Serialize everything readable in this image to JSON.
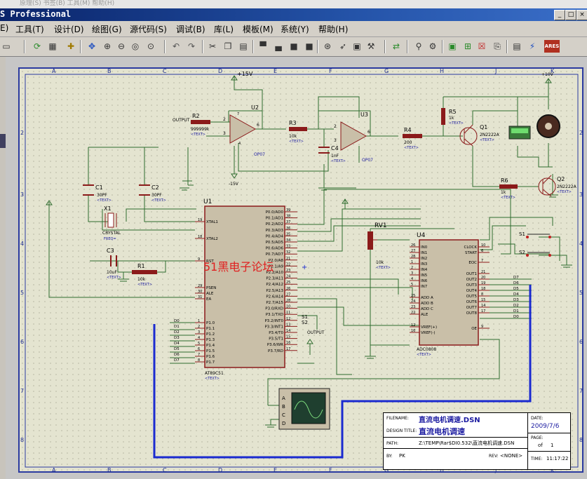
{
  "window": {
    "title": "ISIS Professional",
    "title_partial": "S Professional",
    "ghost_menu": "原理(S)   书签(B)   工具(M)   帮助(H)",
    "buttons": [
      "_",
      "□",
      "×"
    ]
  },
  "menu": [
    "E)",
    "工具(T)",
    "设计(D)",
    "绘图(G)",
    "源代码(S)",
    "调试(B)",
    "库(L)",
    "模板(M)",
    "系统(Y)",
    "帮助(H)"
  ],
  "toolbar_icons": [
    "file-icon",
    "refresh-icon",
    "crosshair-icon",
    "pan-icon",
    "zoom-in-icon",
    "zoom-out-icon",
    "zoom-all-icon",
    "zoom-area-icon",
    "undo-icon",
    "redo-icon",
    "cut-icon",
    "copy-icon",
    "paste-icon",
    "block-copy-icon",
    "block-move-icon",
    "block-rotate-icon",
    "block-delete-icon",
    "pick-device-icon",
    "make-device-icon",
    "package-icon",
    "decompose-icon",
    "wire-autorouter-icon",
    "search-tag-icon",
    "property-assign-icon",
    "new-sheet-icon",
    "remove-sheet-icon",
    "goto-sheet-icon",
    "bill-of-materials-icon",
    "electrical-rules-icon",
    "netlist-ares-icon"
  ],
  "grid": {
    "columns": [
      "A",
      "B",
      "C",
      "D",
      "E",
      "F",
      "G",
      "H",
      "J",
      "K"
    ],
    "rows": [
      "1",
      "2",
      "3",
      "4",
      "5",
      "6",
      "7",
      "8",
      "9"
    ]
  },
  "schematic": {
    "power": {
      "pos15": "+15V",
      "neg15": "-15V",
      "pos10": "+10V"
    },
    "opamps": [
      {
        "ref": "U2",
        "part": "OP07",
        "pins": {
          "in_minus": "2",
          "in_plus": "3",
          "out": "6",
          "v_plus": "7",
          "v_minus": "4",
          "n1": "1",
          "n8": "8"
        }
      },
      {
        "ref": "U3",
        "part": "OP07",
        "pins": {
          "in_minus": "2",
          "in_plus": "3",
          "out": "6",
          "v_plus": "7",
          "v_minus": "4",
          "n1": "1",
          "n8": "8"
        }
      }
    ],
    "resistors": [
      {
        "ref": "R2",
        "value": "999999k"
      },
      {
        "ref": "R3",
        "value": "10k"
      },
      {
        "ref": "R4",
        "value": "200"
      },
      {
        "ref": "R5",
        "value": "1k"
      },
      {
        "ref": "R6",
        "value": "1k"
      },
      {
        "ref": "R1",
        "value": "10k"
      }
    ],
    "text_placeholder": "<TEXT>",
    "capacitors": [
      {
        "ref": "C1",
        "value": "30PF"
      },
      {
        "ref": "C2",
        "value": "30PF"
      },
      {
        "ref": "C3",
        "value": "10uF"
      },
      {
        "ref": "C4",
        "value": "1nF"
      }
    ],
    "transistors": [
      {
        "ref": "Q1",
        "part": "2N2222A"
      },
      {
        "ref": "Q2",
        "part": "2N2222A"
      }
    ],
    "crystal": {
      "ref": "X1",
      "part": "CRYSTAL",
      "freq": "FREQ="
    },
    "output_label": "OUTPUT",
    "rv1": {
      "ref": "RV1",
      "value": "10k"
    },
    "switches": [
      "S1",
      "S2"
    ],
    "u1": {
      "ref": "U1",
      "part": "AT89C51",
      "left_pins": [
        {
          "num": "19",
          "name": "XTAL1"
        },
        {
          "num": "18",
          "name": "XTAL2"
        },
        {
          "num": "9",
          "name": "RST"
        },
        {
          "num": "29",
          "name": "PSEN"
        },
        {
          "num": "30",
          "name": "ALE"
        },
        {
          "num": "31",
          "name": "EA"
        },
        {
          "num": "1",
          "name": "P1.0"
        },
        {
          "num": "2",
          "name": "P1.1"
        },
        {
          "num": "3",
          "name": "P1.2"
        },
        {
          "num": "4",
          "name": "P1.3"
        },
        {
          "num": "5",
          "name": "P1.4"
        },
        {
          "num": "6",
          "name": "P1.5"
        },
        {
          "num": "7",
          "name": "P1.6"
        },
        {
          "num": "8",
          "name": "P1.7"
        }
      ],
      "right_pins": [
        {
          "num": "39",
          "name": "P0.0/AD0"
        },
        {
          "num": "38",
          "name": "P0.1/AD1"
        },
        {
          "num": "37",
          "name": "P0.2/AD2"
        },
        {
          "num": "36",
          "name": "P0.3/AD3"
        },
        {
          "num": "35",
          "name": "P0.4/AD4"
        },
        {
          "num": "34",
          "name": "P0.5/AD5"
        },
        {
          "num": "33",
          "name": "P0.6/AD6"
        },
        {
          "num": "32",
          "name": "P0.7/AD7"
        },
        {
          "num": "21",
          "name": "P2.0/A8"
        },
        {
          "num": "22",
          "name": "P2.1/A9"
        },
        {
          "num": "23",
          "name": "P2.2/A10"
        },
        {
          "num": "24",
          "name": "P2.3/A11"
        },
        {
          "num": "25",
          "name": "P2.4/A12"
        },
        {
          "num": "26",
          "name": "P2.5/A13"
        },
        {
          "num": "27",
          "name": "P2.6/A14"
        },
        {
          "num": "28",
          "name": "P2.7/A15"
        },
        {
          "num": "10",
          "name": "P3.0/RXD"
        },
        {
          "num": "11",
          "name": "P3.1/TXD"
        },
        {
          "num": "12",
          "name": "P3.2/INT0"
        },
        {
          "num": "13",
          "name": "P3.3/INT1"
        },
        {
          "num": "14",
          "name": "P3.4/T0"
        },
        {
          "num": "15",
          "name": "P3.5/T1"
        },
        {
          "num": "16",
          "name": "P3.6/WR"
        },
        {
          "num": "17",
          "name": "P3.7/RD"
        }
      ]
    },
    "u4": {
      "ref": "U4",
      "part": "ADC0808",
      "left_pins": [
        {
          "num": "26",
          "name": "IN0"
        },
        {
          "num": "27",
          "name": "IN1"
        },
        {
          "num": "28",
          "name": "IN2"
        },
        {
          "num": "1",
          "name": "IN3"
        },
        {
          "num": "2",
          "name": "IN4"
        },
        {
          "num": "3",
          "name": "IN5"
        },
        {
          "num": "4",
          "name": "IN6"
        },
        {
          "num": "5",
          "name": "IN7"
        },
        {
          "num": "25",
          "name": "ADD A"
        },
        {
          "num": "24",
          "name": "ADD B"
        },
        {
          "num": "23",
          "name": "ADD C"
        },
        {
          "num": "22",
          "name": "ALE"
        },
        {
          "num": "12",
          "name": "VREF(+)"
        },
        {
          "num": "16",
          "name": "VREF(-)"
        }
      ],
      "right_pins": [
        {
          "num": "10",
          "name": "CLOCK"
        },
        {
          "num": "6",
          "name": "START"
        },
        {
          "num": "7",
          "name": "EOC"
        },
        {
          "num": "21",
          "name": "OUT1"
        },
        {
          "num": "20",
          "name": "OUT2"
        },
        {
          "num": "19",
          "name": "OUT3"
        },
        {
          "num": "18",
          "name": "OUT4"
        },
        {
          "num": "8",
          "name": "OUT5"
        },
        {
          "num": "15",
          "name": "OUT6"
        },
        {
          "num": "14",
          "name": "OUT7"
        },
        {
          "num": "17",
          "name": "OUT8"
        },
        {
          "num": "9",
          "name": "OE"
        }
      ],
      "out_labels": [
        "D7",
        "D6",
        "D5",
        "D4",
        "D3",
        "D2",
        "D1",
        "D0"
      ]
    },
    "p1_labels": [
      "D0",
      "D1",
      "D2",
      "D3",
      "D4",
      "D5",
      "D6",
      "D7"
    ],
    "s_labels": [
      "S1",
      "S2"
    ],
    "watermark": "51黑电子论坛",
    "scope_channels": [
      "A",
      "B",
      "C",
      "D"
    ]
  },
  "title_block": {
    "filename_label": "FILENAME:",
    "filename": "直流电机调速.DSN",
    "design_title_label": "DESIGN TITLE:",
    "design_title": "直流电机调速",
    "path_label": "PATH:",
    "path": "Z:\\TEMP\\Rar$DI0.532\\直流电机调速.DSN",
    "by_label": "BY:",
    "by": "PK",
    "rev_label": "REV:",
    "rev": "<NONE>",
    "date_label": "DATE:",
    "date": "2009/7/6",
    "page_label": "PAGE:",
    "page": "1",
    "of_label": "of",
    "of": "1",
    "time_label": "TIME:",
    "time": "11:17:22"
  },
  "colors": {
    "wire": "#2e6b2e",
    "component": "#8b1a1a",
    "body": "#c9bfa8",
    "label": "#1a1aa0",
    "bus": "#1a2ad0",
    "watermark": "#e02020"
  }
}
